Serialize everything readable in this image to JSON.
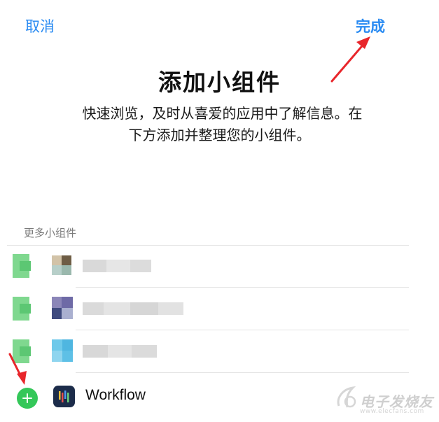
{
  "nav": {
    "cancel_label": "取消",
    "done_label": "完成"
  },
  "header": {
    "title": "添加小组件",
    "description_line1": "快速浏览，及时从喜爱的应用中了解信息。在",
    "description_line2": "下方添加并整理您的小组件。"
  },
  "section": {
    "title": "更多小组件"
  },
  "widgets": [
    {
      "label": "",
      "blurred": true
    },
    {
      "label": "",
      "blurred": true
    },
    {
      "label": "",
      "blurred": true
    },
    {
      "label": "Workflow",
      "blurred": false,
      "icon": "workflow-app-icon"
    }
  ],
  "watermark": {
    "text": "电子发烧友",
    "sub": "www.elecfans.com"
  },
  "colors": {
    "accent": "#2a8bf2",
    "add_green": "#34c759",
    "annotation_red": "#e8262b"
  }
}
